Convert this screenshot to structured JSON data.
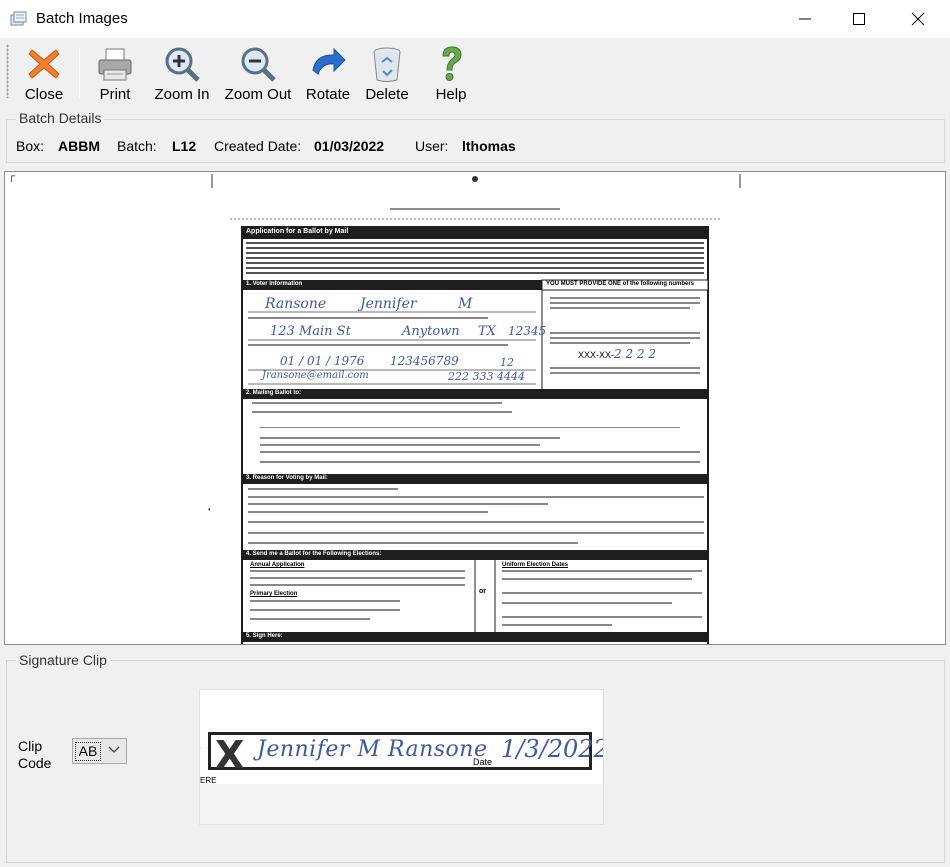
{
  "window": {
    "title": "Batch Images"
  },
  "toolbar": {
    "close": "Close",
    "print": "Print",
    "zoom_in": "Zoom In",
    "zoom_out": "Zoom Out",
    "rotate": "Rotate",
    "delete": "Delete",
    "help": "Help"
  },
  "batch_details": {
    "legend": "Batch Details",
    "box_label": "Box:",
    "box_value": "ABBM",
    "batch_label": "Batch:",
    "batch_value": "L12",
    "created_label": "Created Date:",
    "created_value": "01/03/2022",
    "user_label": "User:",
    "user_value": "lthomas"
  },
  "document": {
    "title": "Application for a Ballot by Mail",
    "section1": "1. Voter Information",
    "section1_right": "YOU MUST PROVIDE ONE of the following numbers",
    "last_name": "Ransone",
    "first_name": "Jennifer",
    "middle": "M",
    "address": "123 Main St",
    "city": "Anytown",
    "state": "TX",
    "zip": "12345",
    "dob": "01 / 01 / 1976",
    "id_number": "123456789",
    "email": "Jransone@email.com",
    "phone": "222 333 4444",
    "ssn_prefix": "XXX-XX-",
    "ssn_last4": "2 2 2 2",
    "section2": "2. Mailing Ballot to:",
    "section3": "3. Reason for Voting by Mail:",
    "section4": "4. Send me a Ballot for the Following Elections:",
    "section5": "5. Sign Here:",
    "annual": "Annual Application",
    "uniform": "Uniform Election Dates",
    "or": "or",
    "primary": "Primary Election",
    "unit": "12"
  },
  "signature_clip": {
    "legend": "Signature Clip",
    "clip_label_line1": "Clip",
    "clip_label_line2": "Code",
    "clip_code": "AB",
    "signature": "Jennifer M Ransone",
    "date": "1/3/2022",
    "date_label": "Date",
    "fragment": "ERE"
  },
  "colors": {
    "form_header": "#1e1e1e",
    "handwriting": "#3c5aa0",
    "close_icon": "#f08030",
    "rotate_icon": "#2a6fd0",
    "help_icon": "#6aa84f"
  }
}
